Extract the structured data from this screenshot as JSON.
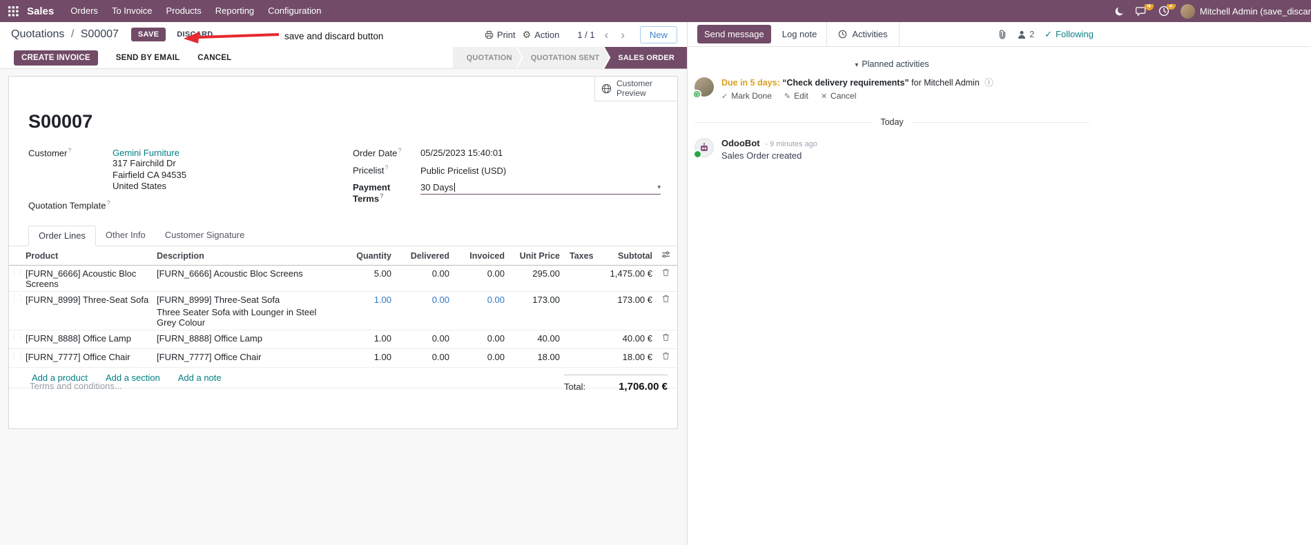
{
  "icons": {
    "gear": "⚙",
    "chevron_left": "‹",
    "chevron_right": "›",
    "caret_down": "▾",
    "collapse_caret": "▾",
    "check": "✓",
    "pencil": "✎",
    "cross": "✕",
    "info": "ⓘ",
    "drag_handle": "⋮⋮",
    "help": "?"
  },
  "topbar": {
    "app_name": "Sales",
    "menus": [
      "Orders",
      "To Invoice",
      "Products",
      "Reporting",
      "Configuration"
    ],
    "badges": {
      "messages": "4",
      "activities": "2"
    },
    "user": "Mitchell Admin (save_discar"
  },
  "breadcrumb": {
    "parent": "Quotations",
    "separator": "/",
    "current": "S00007",
    "save": "SAVE",
    "discard": "DISCARD"
  },
  "annotation": {
    "text": "save and discard button"
  },
  "control": {
    "print": "Print",
    "action": "Action",
    "pager": "1 / 1",
    "new": "New"
  },
  "statusbar": {
    "create_invoice": "CREATE INVOICE",
    "send_by_email": "SEND BY EMAIL",
    "cancel": "CANCEL",
    "states": [
      {
        "label": "QUOTATION",
        "active": false
      },
      {
        "label": "QUOTATION SENT",
        "active": false
      },
      {
        "label": "SALES ORDER",
        "active": true
      }
    ]
  },
  "form": {
    "customer_preview": "Customer Preview",
    "title": "S00007",
    "customer_label": "Customer",
    "customer_value": "Gemini Furniture",
    "address": [
      "317 Fairchild Dr",
      "Fairfield CA 94535",
      "United States"
    ],
    "quotation_template_label": "Quotation Template",
    "order_date_label": "Order Date",
    "order_date_value": "05/25/2023 15:40:01",
    "pricelist_label": "Pricelist",
    "pricelist_value": "Public Pricelist (USD)",
    "payment_terms_label": "Payment Terms",
    "payment_terms_value": "30 Days",
    "tabs": [
      {
        "label": "Order Lines",
        "active": true
      },
      {
        "label": "Other Info",
        "active": false
      },
      {
        "label": "Customer Signature",
        "active": false
      }
    ],
    "columns": {
      "product": "Product",
      "description": "Description",
      "quantity": "Quantity",
      "delivered": "Delivered",
      "invoiced": "Invoiced",
      "unit_price": "Unit Price",
      "taxes": "Taxes",
      "subtotal": "Subtotal"
    },
    "rows": [
      {
        "product": "[FURN_6666] Acoustic Bloc Screens",
        "description": "[FURN_6666] Acoustic Bloc Screens",
        "description2": "",
        "quantity": "5.00",
        "delivered": "0.00",
        "invoiced": "0.00",
        "unit_price": "295.00",
        "taxes": "",
        "subtotal": "1,475.00 €"
      },
      {
        "product": "[FURN_8999] Three-Seat Sofa",
        "description": "[FURN_8999] Three-Seat Sofa",
        "description2": "Three Seater Sofa with Lounger in Steel Grey Colour",
        "quantity": "1.00",
        "delivered": "0.00",
        "invoiced": "0.00",
        "unit_price": "173.00",
        "taxes": "",
        "subtotal": "173.00 €"
      },
      {
        "product": "[FURN_8888] Office Lamp",
        "description": "[FURN_8888] Office Lamp",
        "description2": "",
        "quantity": "1.00",
        "delivered": "0.00",
        "invoiced": "0.00",
        "unit_price": "40.00",
        "taxes": "",
        "subtotal": "40.00 €"
      },
      {
        "product": "[FURN_7777] Office Chair",
        "description": "[FURN_7777] Office Chair",
        "description2": "",
        "quantity": "1.00",
        "delivered": "0.00",
        "invoiced": "0.00",
        "unit_price": "18.00",
        "taxes": "",
        "subtotal": "18.00 €"
      }
    ],
    "add_product": "Add a product",
    "add_section": "Add a section",
    "add_note": "Add a note",
    "terms_placeholder": "Terms and conditions...",
    "total_label": "Total:",
    "total_value": "1,706.00 €"
  },
  "chatter": {
    "send_message": "Send message",
    "log_note": "Log note",
    "activities": "Activities",
    "followers_count": "2",
    "following": "Following",
    "planned": "Planned activities",
    "activity": {
      "due": "Due in 5 days:",
      "summary": "“Check delivery requirements”",
      "for_user": "for Mitchell Admin",
      "mark_done": "Mark Done",
      "edit": "Edit",
      "cancel": "Cancel"
    },
    "today": "Today",
    "message": {
      "author": "OdooBot",
      "time": "- 9 minutes ago",
      "body": "Sales Order created"
    }
  }
}
